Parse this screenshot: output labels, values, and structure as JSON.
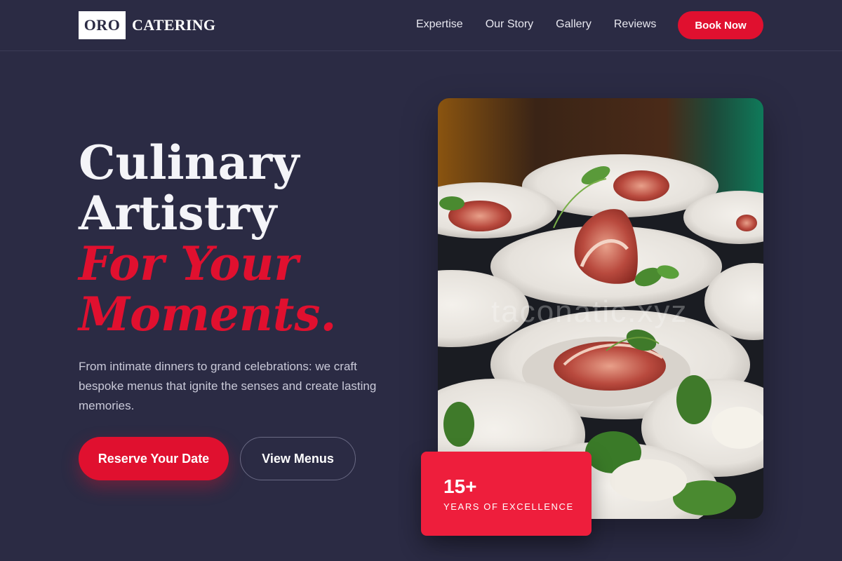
{
  "brand": {
    "box_text": "ORO",
    "name": "CATERING"
  },
  "nav": {
    "items": [
      "Expertise",
      "Our Story",
      "Gallery",
      "Reviews"
    ],
    "cta": "Book Now"
  },
  "hero": {
    "title_line1": "Culinary",
    "title_line2": "Artistry",
    "title_line3": "For Your",
    "title_line4": "Moments.",
    "description": "From intimate dinners to grand celebrations: we craft bespoke menus that ignite the senses and create lasting memories.",
    "primary_button": "Reserve Your Date",
    "secondary_button": "View Menus"
  },
  "image": {
    "watermark": "taconatic.xyz"
  },
  "badge": {
    "number": "15+",
    "label": "YEARS OF EXCELLENCE"
  },
  "colors": {
    "background": "#2b2b44",
    "accent": "#e0102f",
    "badge": "#ee1e3c"
  }
}
